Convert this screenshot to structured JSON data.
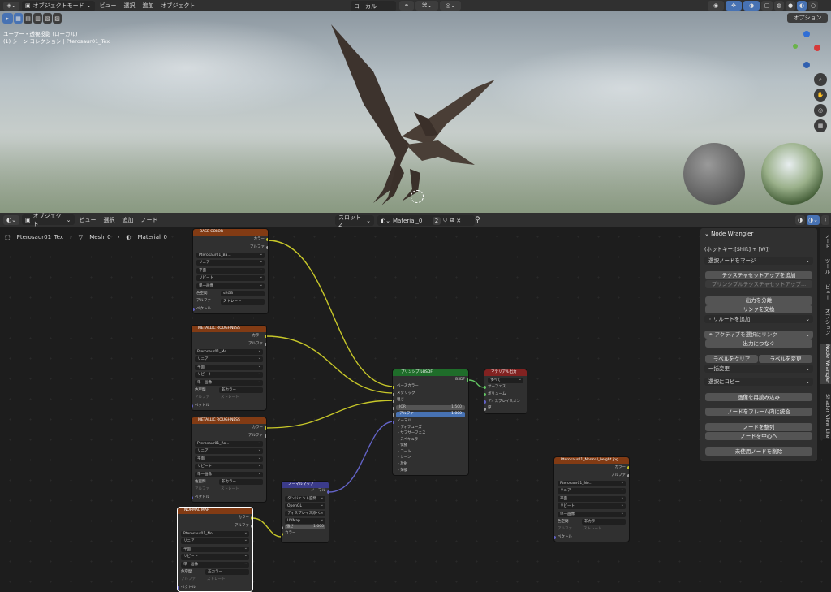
{
  "top_header": {
    "mode": "オブジェクトモード",
    "menus": [
      "ビュー",
      "選択",
      "追加",
      "オブジェクト"
    ],
    "transform": "ローカル",
    "options": "オプション"
  },
  "viewport": {
    "line1": "ユーザー・透視投影 (ローカル)",
    "line2": "(1) シーン コレクション | Pterosaur01_Tex"
  },
  "node_header": {
    "mode": "オブジェクト",
    "menus": [
      "ビュー",
      "選択",
      "追加",
      "ノード"
    ],
    "slot": "スロット2",
    "material": "Material_0",
    "users": "2"
  },
  "breadcrumb": {
    "object": "Pterosaur01_Tex",
    "mesh": "Mesh_0",
    "material": "Material_0"
  },
  "colors": {
    "texture_header": "#823b14",
    "shader_header": "#1f6d2a",
    "output_header": "#822221",
    "vector_header": "#3b3b8a",
    "blue": "#4772b3"
  },
  "nodes": {
    "base_color": {
      "title": "BASE COLOR",
      "out_color": "カラー",
      "out_alpha": "アルファ",
      "image": "Pterosaur01_Ba...",
      "interp": "リニア",
      "proj": "平面",
      "ext": "リピート",
      "frame": "単一画像",
      "cs_label": "色空間",
      "cs": "sRGB",
      "alpha_label": "アルファ",
      "alpha": "ストレート",
      "vec": "ベクトル"
    },
    "metal1": {
      "title": "METALLIC ROUGHNESS",
      "out_color": "カラー",
      "out_alpha": "アルファ",
      "image": "Pterosaur01_Me...",
      "interp": "リニア",
      "proj": "平面",
      "ext": "リピート",
      "frame": "単一画像",
      "cs_label": "色空間",
      "cs": "非カラー",
      "alpha_label": "アルファ",
      "alpha": "ストレート",
      "vec": "ベクトル"
    },
    "metal2": {
      "title": "METALLIC ROUGHNESS",
      "out_color": "カラー",
      "out_alpha": "アルファ",
      "image": "Pterosaur01_Ro...",
      "interp": "リニア",
      "proj": "平面",
      "ext": "リピート",
      "frame": "単一画像",
      "cs_label": "色空間",
      "cs": "非カラー",
      "alpha_label": "アルファ",
      "alpha": "ストレート",
      "vec": "ベクトル"
    },
    "normal_tex": {
      "title": "NORMAL MAP",
      "out_color": "カラー",
      "out_alpha": "アルファ",
      "image": "Pterosaur01_No...",
      "interp": "リニア",
      "proj": "平面",
      "ext": "リピート",
      "frame": "単一画像",
      "cs_label": "色空間",
      "cs": "非カラー",
      "alpha_label": "アルファ",
      "alpha": "ストレート",
      "vec": "ベクトル"
    },
    "normal_map": {
      "title": "ノーマルマップ",
      "out": "ノーマル",
      "space": "タンジェント空間",
      "conv": "OpenGL",
      "disp": "ディスプレイス添べ...",
      "uv": "UVMap",
      "strength_label": "強さ",
      "strength": "1.000",
      "color": "カラー"
    },
    "bsdf": {
      "title": "プリンシプルBSDF",
      "out": "BSDF",
      "base": "ベースカラー",
      "metal": "メタリック",
      "rough": "粗さ",
      "ior_label": "IOR",
      "ior": "1.500",
      "alpha_label": "アルファ",
      "alpha": "1.000",
      "normal": "ノーマル",
      "subs": [
        "ディフューズ",
        "サブサーフェス",
        "スペキュラー",
        "伝播",
        "コート",
        "シーン",
        "放射",
        "薄膜"
      ]
    },
    "output": {
      "title": "マテリアル出力",
      "target": "すべて",
      "surf": "サーフェス",
      "vol": "ボリューム",
      "disp": "ディスプレイスメント",
      "thick": "厚"
    },
    "normal_height": {
      "title": "Pterosaur01_Normal_height.jpg",
      "out_color": "カラー",
      "out_alpha": "アルファ",
      "image": "Pterosaur01_No...",
      "interp": "リニア",
      "proj": "平面",
      "ext": "リピート",
      "frame": "単一画像",
      "cs_label": "色空間",
      "cs": "非カラー",
      "alpha_label": "アルファ",
      "alpha": "ストレート",
      "vec": "ベクトル"
    }
  },
  "nw": {
    "title": "Node Wrangler",
    "hotkey": "(ホットキー:[Shift] + [W])",
    "merge": "選択ノードをマージ",
    "tex_setup": "テクスチャセットアップを追加",
    "pr_setup": "プリンシプルテクスチャセットアップ...",
    "split": "出力を分離",
    "swap": "リンクを交換",
    "reroute": "リルートを追加",
    "link_active": "アクティブを選択にリンク",
    "connect_out": "出力につなぐ",
    "clear_label": "ラベルをクリア",
    "mod_label": "ラベルを変更",
    "batch": "一括変更",
    "copy": "選択にコピー",
    "reload": "画像を再読み込み",
    "frame": "ノードをフレーム内に統合",
    "align": "ノードを整列",
    "center": "ノードを中心へ",
    "delete": "未使用ノードを削除"
  },
  "side_tabs": [
    "ノード",
    "ツール",
    "ビュー",
    "オプション",
    "Node Wrangler",
    "Shader View Lite"
  ]
}
